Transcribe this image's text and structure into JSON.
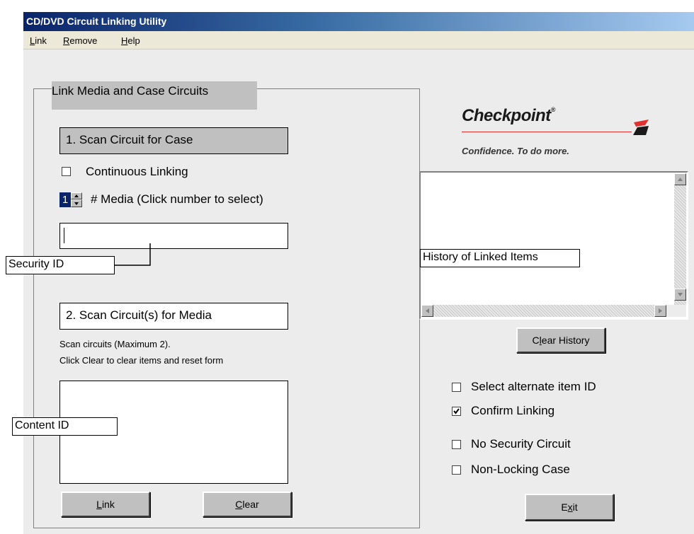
{
  "window": {
    "title": "CD/DVD Circuit Linking Utility"
  },
  "menu": {
    "items": [
      "Link",
      "Remove",
      "Help"
    ]
  },
  "link_group": {
    "title": "Link Media and Case Circuits",
    "step1_label": "1. Scan Circuit for Case",
    "continuous_linking_label": "Continuous Linking",
    "continuous_linking_checked": false,
    "media_count_value": "1",
    "media_count_label": "# Media (Click number to select)",
    "security_id_value": "",
    "step2_label": "2. Scan Circuit(s) for Media",
    "instructions": [
      "Scan circuits (Maximum 2).",
      "Click Clear to clear items and reset form"
    ],
    "link_button": "Link",
    "clear_button": "Clear"
  },
  "callouts": {
    "security_id": "Security ID",
    "content_id": "Content ID",
    "history": "History of Linked Items"
  },
  "logo": {
    "brand": "Checkpoint",
    "trademark": "®",
    "tagline": "Confidence. To do more.",
    "accent_color": "#e03030"
  },
  "history": {
    "items": [],
    "clear_button": "Clear History"
  },
  "options": [
    {
      "label": "Select alternate item ID",
      "checked": false
    },
    {
      "label": "Confirm Linking",
      "checked": true
    },
    {
      "label": "No Security Circuit",
      "checked": false
    },
    {
      "label": "Non-Locking Case",
      "checked": false
    }
  ],
  "exit_button": "Exit"
}
